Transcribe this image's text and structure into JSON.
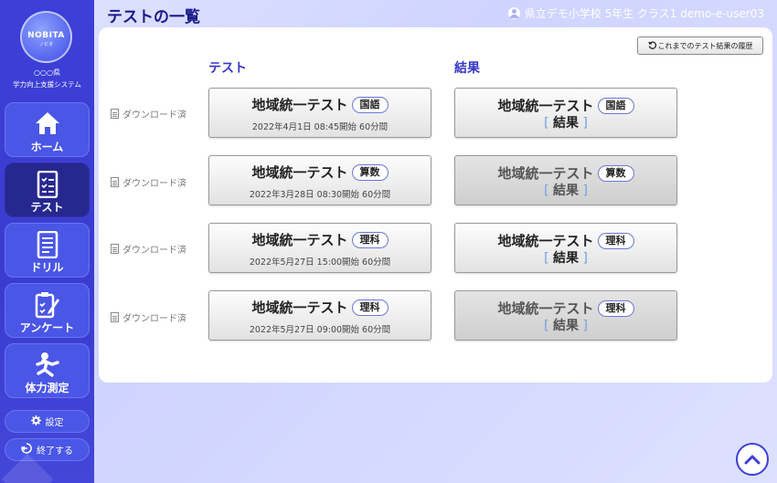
{
  "sidebar": {
    "logo_text": "NOBITA",
    "logo_sub": "ノビタ",
    "org_name": "○○○県",
    "system_name": "学力向上支援システム",
    "nav": [
      {
        "label": "ホーム",
        "icon": "home-icon",
        "active": false
      },
      {
        "label": "テスト",
        "icon": "test-list-icon",
        "active": true
      },
      {
        "label": "ドリル",
        "icon": "drill-icon",
        "active": false
      },
      {
        "label": "アンケート",
        "icon": "survey-icon",
        "active": false
      },
      {
        "label": "体力測定",
        "icon": "fitness-icon",
        "active": false
      }
    ],
    "settings_label": "設定",
    "logout_label": "終了する"
  },
  "header": {
    "title": "テストの一覧",
    "user": "県立デモ小学校 5年生 クラス1 demo-e-user03"
  },
  "main": {
    "history_button": "これまでのテスト結果の履歴",
    "col_test": "テスト",
    "col_result": "結果",
    "rows": [
      {
        "status": "ダウンロード済",
        "test_name": "地域統一テスト",
        "subject": "国語",
        "date": "2022年4月1日  08:45開始  60分間",
        "result_label": "結果",
        "result_available": true
      },
      {
        "status": "ダウンロード済",
        "test_name": "地域統一テスト",
        "subject": "算数",
        "date": "2022年3月28日  08:30開始  60分間",
        "result_label": "結果",
        "result_available": false
      },
      {
        "status": "ダウンロード済",
        "test_name": "地域統一テスト",
        "subject": "理科",
        "date": "2022年5月27日  15:00開始  60分間",
        "result_label": "結果",
        "result_available": true
      },
      {
        "status": "ダウンロード済",
        "test_name": "地域統一テスト",
        "subject": "理科",
        "date": "2022年5月27日  09:00開始  60分間",
        "result_label": "結果",
        "result_available": false
      }
    ]
  },
  "colors": {
    "sidebar": "#3d3fd8",
    "active_nav": "#26288f",
    "title": "#1a1a8a",
    "column_header": "#3537c8",
    "bracket": "#6fa0e6"
  }
}
